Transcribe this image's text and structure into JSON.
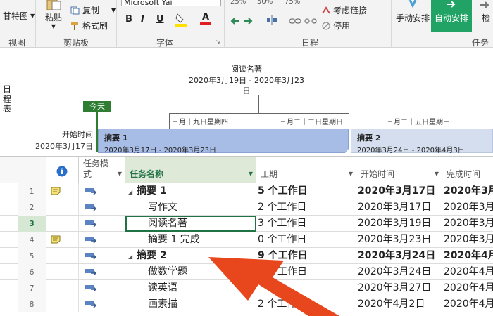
{
  "ribbon": {
    "groups": {
      "view": "视图",
      "clipboard": "剪贴板",
      "font": "字体",
      "schedule": "日程",
      "tasks": "任务"
    },
    "gantt_label": "甘特图",
    "paste_label": "粘贴",
    "copy_label": "复制",
    "format_painter_label": "格式刷",
    "font_name": "Microsoft Yai",
    "bold": "B",
    "italic": "I",
    "underline": "U",
    "font_color": "A",
    "respect_links_label": "考虑链接",
    "deactivate_label": "停用",
    "manual_schedule_label": "手动安排",
    "auto_schedule_label": "自动安排",
    "inspect_label": "检",
    "pct_labels": [
      "25%",
      "50%",
      "75%"
    ]
  },
  "timeline": {
    "side_label": "日程表",
    "task_title": "阅读名著",
    "task_range": "2020年3月19日 - 2020年3月23",
    "task_range_wrap": "日",
    "today_label": "今天",
    "start_label": "开始时间",
    "start_date": "2020年3月17日",
    "date_ticks": [
      "三月十九日星期四",
      "三月二十二日星期日",
      "三月二十五日星期三"
    ],
    "bars": [
      {
        "title": "摘要 1",
        "dates": "2020年3月17日 - 2020年3月23日"
      },
      {
        "title": "摘要 2",
        "dates": "2020年3月24日 - 2020年4月3日"
      }
    ]
  },
  "grid": {
    "headers": {
      "info": "i",
      "mode": "任务模式",
      "name": "任务名称",
      "duration": "工期",
      "start": "开始时间",
      "finish": "完成时间"
    },
    "rows": [
      {
        "num": "1",
        "note": true,
        "summary": true,
        "name": "摘要 1",
        "duration": "5 个工作日",
        "start": "2020年3月17日",
        "finish": "2020年3月"
      },
      {
        "num": "2",
        "note": false,
        "summary": false,
        "name": "写作文",
        "duration": "2 个工作日",
        "start": "2020年3月17日",
        "finish": "2020年3月"
      },
      {
        "num": "3",
        "note": false,
        "summary": false,
        "name": "阅读名著",
        "duration": "3 个工作日",
        "start": "2020年3月19日",
        "finish": "2020年3月"
      },
      {
        "num": "4",
        "note": true,
        "summary": false,
        "name": "摘要 1 完成",
        "duration": "0 个工作日",
        "start": "2020年3月23日",
        "finish": "2020年3月"
      },
      {
        "num": "5",
        "note": false,
        "summary": true,
        "name": "摘要 2",
        "duration": "9 个工作日",
        "start": "2020年3月24日",
        "finish": "2020年4月"
      },
      {
        "num": "6",
        "note": false,
        "summary": false,
        "name": "做数学题",
        "duration": "个工作日",
        "start": "2020年3月24日",
        "finish": "2020年4月"
      },
      {
        "num": "7",
        "note": false,
        "summary": false,
        "name": "读英语",
        "duration": "",
        "start": "2020年3月27日",
        "finish": "2020年4月"
      },
      {
        "num": "8",
        "note": false,
        "summary": false,
        "name": "画素描",
        "duration": "2 个工作日",
        "start": "2020年4月2日",
        "finish": "2020年4月"
      }
    ],
    "selected_row": "3"
  },
  "colors": {
    "green_accent": "#217346",
    "today_green": "#2e7d32",
    "summary_bar": "#a8bde6",
    "arrow_red": "#e8461c"
  }
}
